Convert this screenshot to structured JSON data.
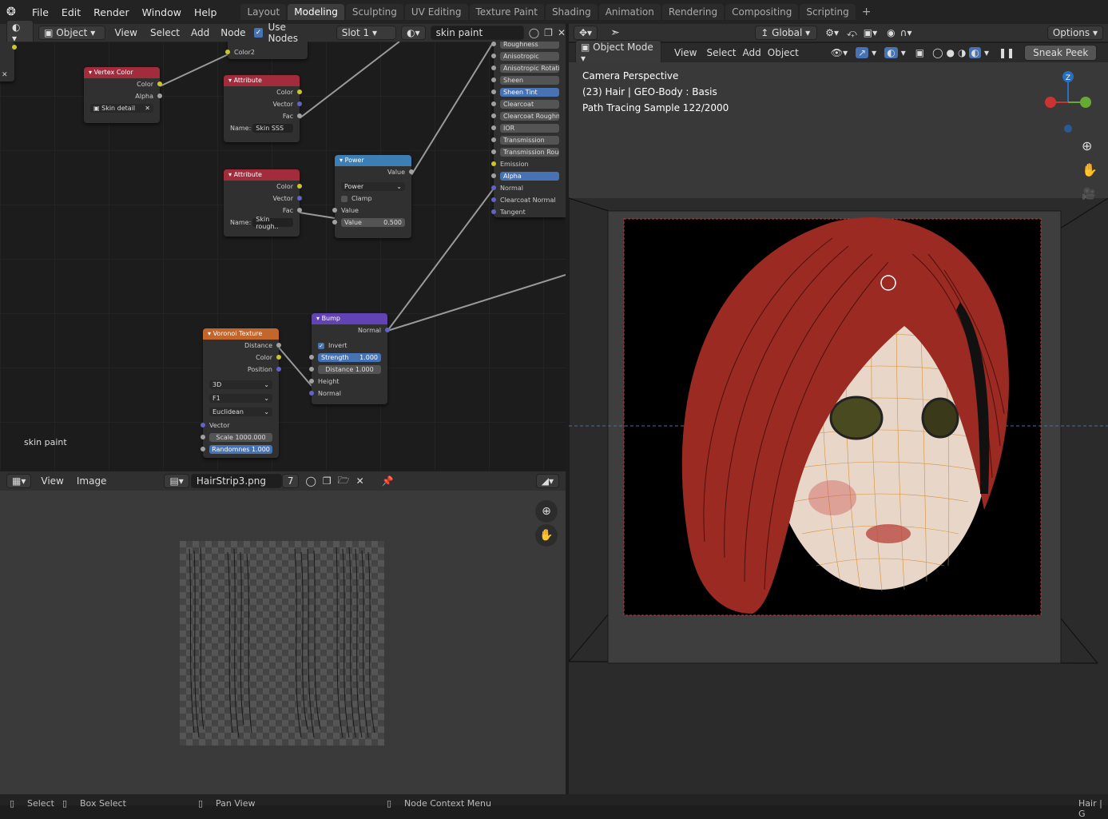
{
  "topbar": {
    "menus": [
      "File",
      "Edit",
      "Render",
      "Window",
      "Help"
    ],
    "workspaces": [
      "Layout",
      "Modeling",
      "Sculpting",
      "UV Editing",
      "Texture Paint",
      "Shading",
      "Animation",
      "Rendering",
      "Compositing",
      "Scripting"
    ],
    "active_workspace": "Modeling",
    "add_tab": "+"
  },
  "node_editor": {
    "object_mode": "Object",
    "menus": [
      "View",
      "Select",
      "Add",
      "Node"
    ],
    "use_nodes_label": "Use Nodes",
    "slot": "Slot 1",
    "material": "skin paint",
    "corner_label": "skin paint",
    "nodes": {
      "color2_node": {
        "socket": "Color2"
      },
      "vertex_color": {
        "title": "Vertex Color",
        "outputs": [
          "Color",
          "Alpha"
        ],
        "layer": "Skin detail"
      },
      "attribute1": {
        "title": "Attribute",
        "outputs": [
          "Color",
          "Vector",
          "Fac"
        ],
        "name_label": "Name:",
        "name": "Skin SSS"
      },
      "attribute2": {
        "title": "Attribute",
        "outputs": [
          "Color",
          "Vector",
          "Fac"
        ],
        "name_label": "Name:",
        "name": "Skin rough.."
      },
      "power": {
        "title": "Power",
        "output": "Value",
        "operation": "Power",
        "clamp": "Clamp",
        "input": "Value",
        "value_label": "Value",
        "value": "0.500"
      },
      "voronoi": {
        "title": "Voronoi Texture",
        "outputs": [
          "Distance",
          "Color",
          "Position"
        ],
        "dim": "3D",
        "feature": "F1",
        "metric": "Euclidean",
        "vector": "Vector",
        "scale_label": "Scale",
        "scale": "1000.000",
        "random_label": "Randomnes",
        "random": "1.000"
      },
      "bump": {
        "title": "Bump",
        "output": "Normal",
        "invert": "Invert",
        "strength_label": "Strength",
        "strength": "1.000",
        "distance_label": "Distance",
        "distance": "1.000",
        "inputs": [
          "Height",
          "Normal"
        ]
      },
      "principled": {
        "rows": [
          "Roughness",
          "Anisotropic",
          "Anisotropic Rotation",
          "Sheen",
          "Sheen Tint",
          "Clearcoat",
          "Clearcoat Roughness",
          "IOR",
          "Transmission",
          "Transmission Roughn",
          "Emission",
          "Alpha",
          "Normal",
          "Clearcoat Normal",
          "Tangent"
        ]
      }
    }
  },
  "image_editor": {
    "menus": [
      "View",
      "Image"
    ],
    "image_name": "HairStrip3.png",
    "users": "7"
  },
  "viewport": {
    "orientation": "Global",
    "options": "Options",
    "mode": "Object Mode",
    "menus": [
      "View",
      "Select",
      "Add",
      "Object"
    ],
    "sneak_peek": "Sneak Peek",
    "overlay": [
      "Camera Perspective",
      "(23) Hair | GEO-Body : Basis",
      "Path Tracing Sample 122/2000"
    ],
    "gizmo_axis": "Z"
  },
  "statusbar": {
    "items": [
      "Select",
      "Box Select",
      "Pan View",
      "Node Context Menu"
    ],
    "right": "Hair | G"
  },
  "colors": {
    "accent": "#4772b3",
    "attribute": "#a22b3c",
    "converter": "#3d7fb5",
    "texture": "#c2662b",
    "vector": "#6243b3"
  }
}
